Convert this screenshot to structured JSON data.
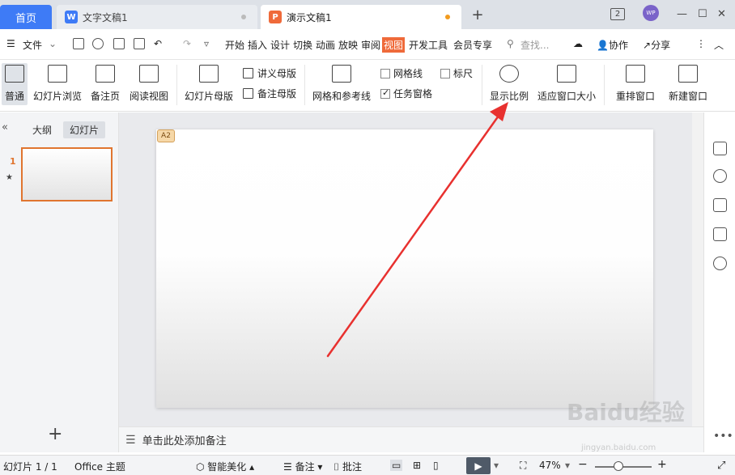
{
  "tabbar": {
    "home": "首页",
    "tabs": [
      {
        "label": "文字文稿1",
        "icon": "W"
      },
      {
        "label": "演示文稿1",
        "icon": "P"
      }
    ],
    "badge": "2",
    "avatar": "WP"
  },
  "menubar": {
    "file": "文件",
    "items": [
      "开始",
      "插入",
      "设计",
      "切换",
      "动画",
      "放映",
      "审阅",
      "视图",
      "开发工具",
      "会员专享"
    ],
    "search_placeholder": "查找...",
    "collab": "协作",
    "share": "分享"
  },
  "ribbon": {
    "normal": "普通",
    "slide_browse": "幻灯片浏览",
    "notes_page": "备注页",
    "reading_view": "阅读视图",
    "slide_master": "幻灯片母版",
    "handout_master": "讲义母版",
    "notes_master": "备注母版",
    "grid_guides": "网格和参考线",
    "gridlines": "网格线",
    "ruler": "标尺",
    "task_pane": "任务窗格",
    "zoom": "显示比例",
    "fit_window": "适应窗口大小",
    "arrange": "重排窗口",
    "new_window": "新建窗口"
  },
  "leftpanel": {
    "outline_tab": "大纲",
    "slides_tab": "幻灯片",
    "slide_number": "1",
    "add": "+"
  },
  "canvas": {
    "comment_badge": "A2"
  },
  "notes": {
    "placeholder": "单击此处添加备注"
  },
  "statusbar": {
    "slide_count": "幻灯片 1 / 1",
    "theme": "Office 主题",
    "beautify": "智能美化",
    "notes": "备注",
    "comments": "批注",
    "zoom": "47%"
  },
  "watermark": {
    "brand": "Baidu经验",
    "url": "jingyan.baidu.com"
  },
  "colors": {
    "accent_blue": "#3e7bf6",
    "accent_orange": "#ef6a3a",
    "arrow_red": "#e8312f"
  }
}
